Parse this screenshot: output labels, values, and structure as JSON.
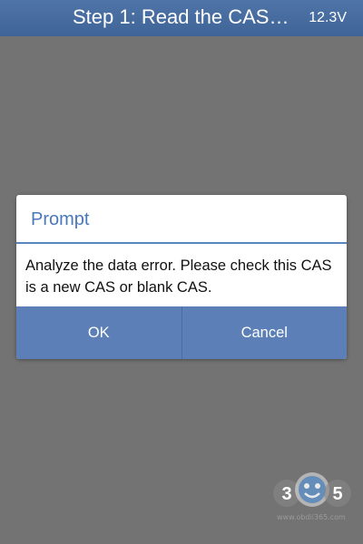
{
  "header": {
    "title": "Step 1: Read the CAS…",
    "voltage": "12.3V"
  },
  "dialog": {
    "title": "Prompt",
    "message": "Analyze the data error. Please check this CAS is a new CAS or blank CAS.",
    "buttons": {
      "ok": "OK",
      "cancel": "Cancel"
    }
  },
  "watermark": {
    "logo_text": "3 5",
    "url": "www.obdii365.com"
  },
  "colors": {
    "header_bg": "#4a70a4",
    "background": "#737373",
    "dialog_title": "#4a78b8",
    "dialog_buttons_bg": "#5b7fb6"
  }
}
